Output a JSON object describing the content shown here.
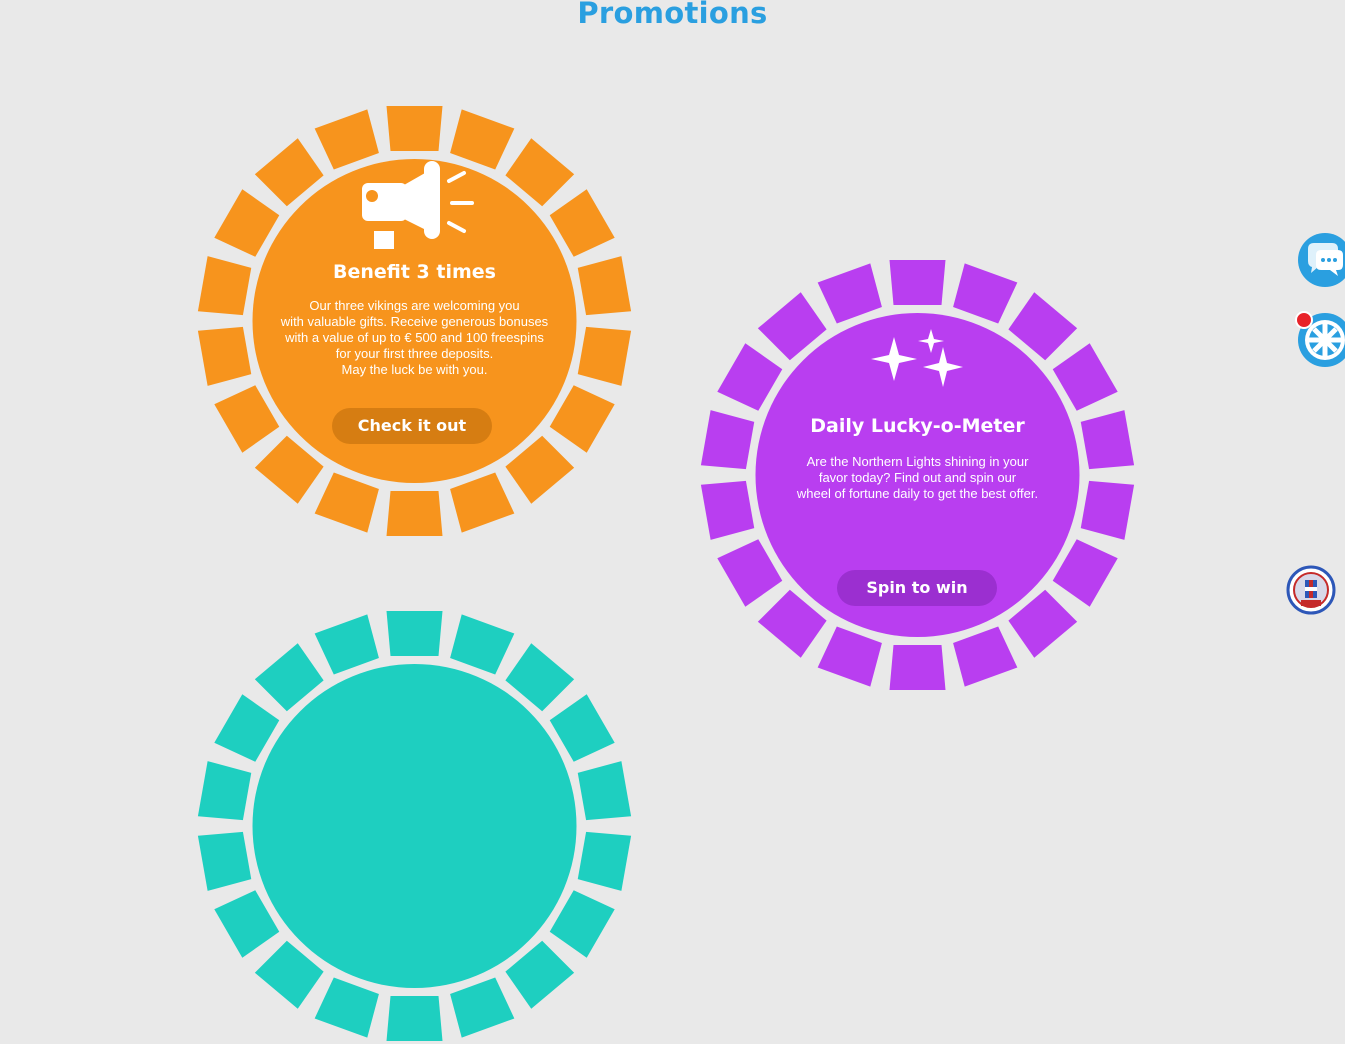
{
  "page": {
    "title": "Promotions"
  },
  "promotions": [
    {
      "title": "Benefit 3 times",
      "description": "Our three vikings are welcoming you\nwith valuable gifts. Receive generous bonuses\nwith a value of up to € 500 and 100 freespins\nfor your first three deposits.\nMay the luck be with you.",
      "button_label": "Check it out",
      "icon": "megaphone-icon",
      "color": "#f7941d",
      "button_color": "#d67d12"
    },
    {
      "title": "Daily Lucky-o-Meter",
      "description": "Are the Northern Lights shining in your\nfavor today? Find out and spin our\nwheel of fortune daily to get the best offer.",
      "button_label": "Spin to win",
      "icon": "sparkles-icon",
      "color": "#b93ef0",
      "button_color": "#9b2fd0"
    },
    {
      "color": "#1ecfc0"
    }
  ],
  "side_widgets": {
    "chat_icon": "chat-bubble-icon",
    "wheel_icon": "wheel-of-fortune-icon",
    "chat_color": "#2a9fe0",
    "wheel_color": "#2a9fe0"
  },
  "footer": {
    "seal_icon": "license-seal-icon"
  }
}
